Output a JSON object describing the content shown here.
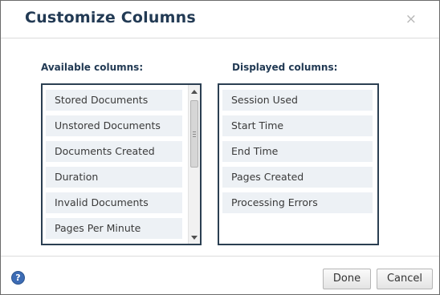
{
  "dialog": {
    "title": "Customize Columns",
    "close_icon": "close-icon",
    "close_glyph": "×"
  },
  "available": {
    "label": "Available columns:",
    "items": [
      "Stored Documents",
      "Unstored Documents",
      "Documents Created",
      "Duration",
      "Invalid Documents",
      "Pages Per Minute"
    ]
  },
  "displayed": {
    "label": "Displayed columns:",
    "items": [
      "Session Used",
      "Start Time",
      "End Time",
      "Pages Created",
      "Processing Errors"
    ]
  },
  "footer": {
    "help_icon": "help-icon",
    "help_glyph": "?",
    "done_label": "Done",
    "cancel_label": "Cancel"
  },
  "colors": {
    "title": "#223a54",
    "list_border": "#2b3f52",
    "item_bg": "#edf1f5",
    "help": "#3d6cb5"
  }
}
